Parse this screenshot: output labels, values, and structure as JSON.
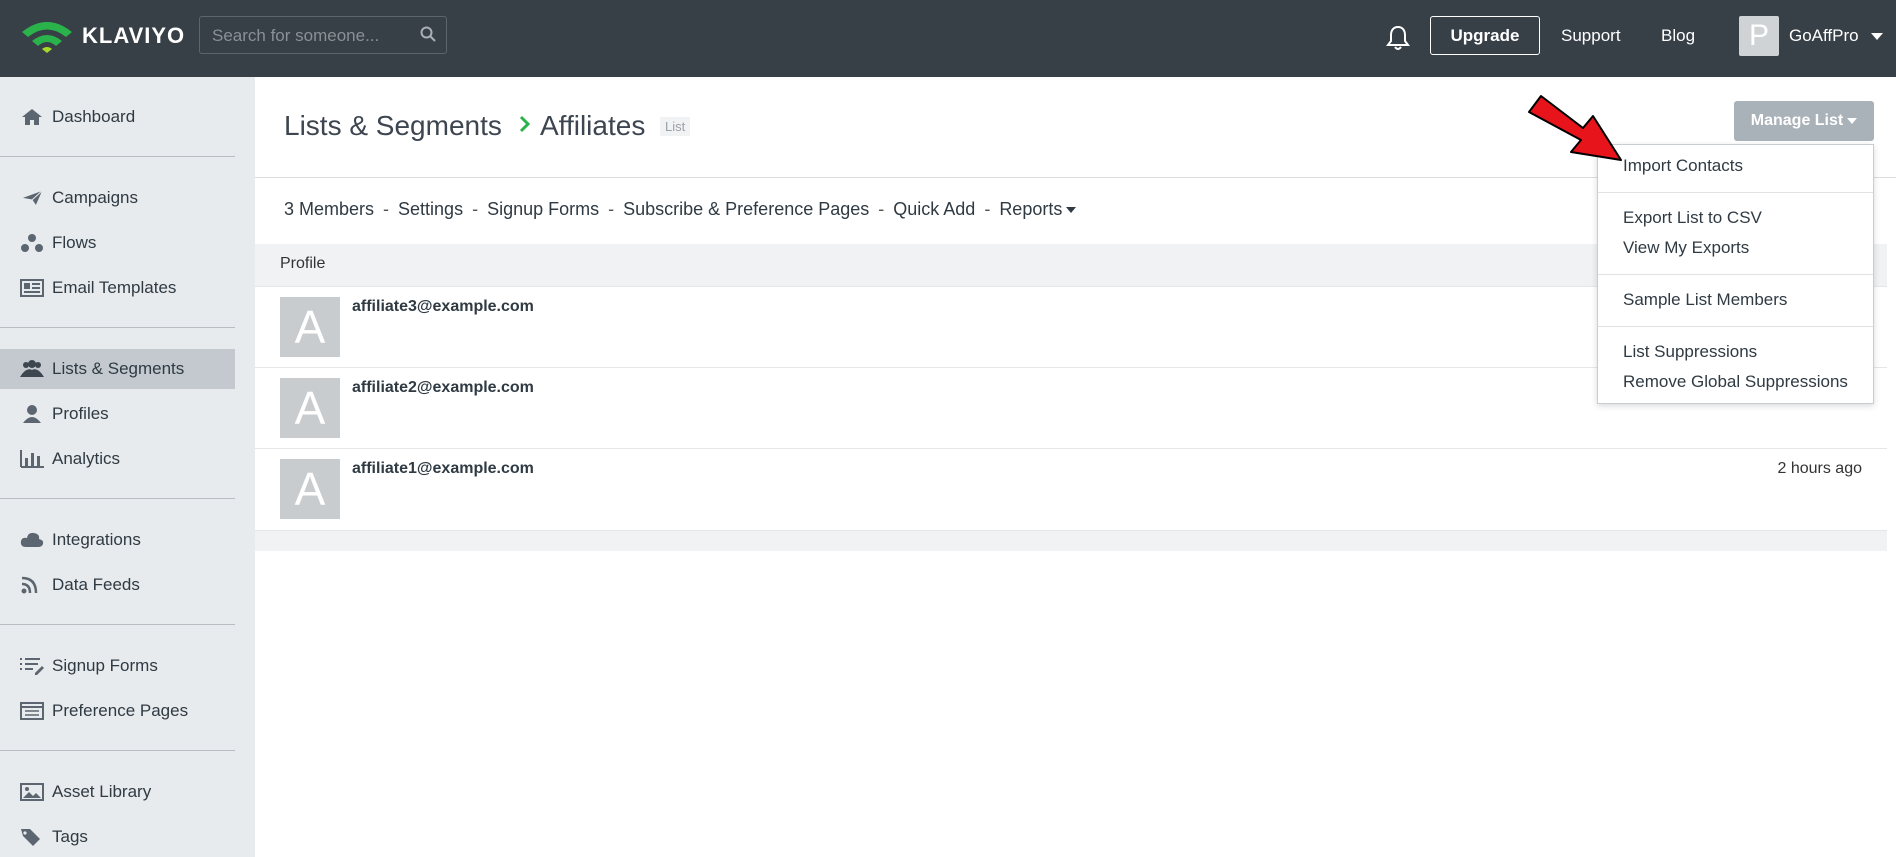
{
  "topbar": {
    "logo_text": "KLAVIYO",
    "search_placeholder": "Search for someone...",
    "upgrade_label": "Upgrade",
    "support_label": "Support",
    "blog_label": "Blog",
    "avatar_letter": "P",
    "account_name": "GoAffPro"
  },
  "sidebar": {
    "items": [
      {
        "label": "Dashboard",
        "icon": "home-icon"
      },
      {
        "label": "Campaigns",
        "icon": "paper-plane-icon"
      },
      {
        "label": "Flows",
        "icon": "flows-icon"
      },
      {
        "label": "Email Templates",
        "icon": "template-icon"
      },
      {
        "label": "Lists & Segments",
        "icon": "users-icon",
        "active": true
      },
      {
        "label": "Profiles",
        "icon": "user-icon"
      },
      {
        "label": "Analytics",
        "icon": "bar-chart-icon"
      },
      {
        "label": "Integrations",
        "icon": "cloud-icon"
      },
      {
        "label": "Data Feeds",
        "icon": "rss-icon"
      },
      {
        "label": "Signup Forms",
        "icon": "form-list-icon"
      },
      {
        "label": "Preference Pages",
        "icon": "preference-page-icon"
      },
      {
        "label": "Asset Library",
        "icon": "image-icon"
      },
      {
        "label": "Tags",
        "icon": "tag-icon"
      }
    ]
  },
  "header": {
    "breadcrumb_parent": "Lists & Segments",
    "current": "Affiliates",
    "tag": "List",
    "manage_label": "Manage List"
  },
  "subnav": {
    "members": "3 Members",
    "settings": "Settings",
    "signup_forms": "Signup Forms",
    "subscribe_pages": "Subscribe & Preference Pages",
    "quick_add": "Quick Add",
    "reports": "Reports",
    "separator": "-"
  },
  "table": {
    "column_profile": "Profile",
    "rows": [
      {
        "avatar": "A",
        "email": "affiliate3@example.com",
        "time": ""
      },
      {
        "avatar": "A",
        "email": "affiliate2@example.com",
        "time": ""
      },
      {
        "avatar": "A",
        "email": "affiliate1@example.com",
        "time": "2 hours ago"
      }
    ]
  },
  "dropdown": {
    "import_contacts": "Import Contacts",
    "export_csv": "Export List to CSV",
    "view_exports": "View My Exports",
    "sample_members": "Sample List Members",
    "list_suppressions": "List Suppressions",
    "remove_global": "Remove Global Suppressions"
  },
  "colors": {
    "topbar": "#373f47",
    "sidebar": "#e8ebed",
    "accent_green": "#2bb34b",
    "annotation_arrow": "#e8141c"
  }
}
